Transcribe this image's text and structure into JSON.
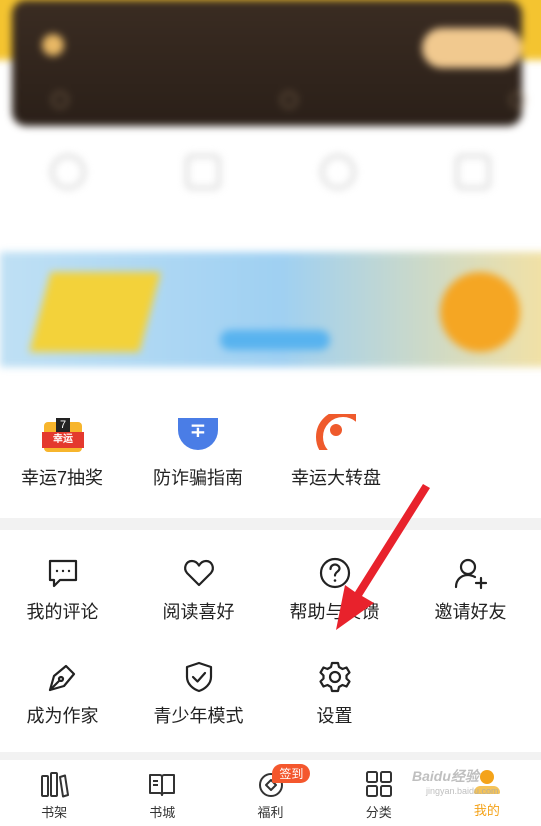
{
  "activities": [
    {
      "label": "幸运7抽奖",
      "icon": "lucky-seven-icon",
      "tag": "幸运",
      "num": "7"
    },
    {
      "label": "防诈骗指南",
      "icon": "anti-fraud-shield-icon",
      "glyph": "∓"
    },
    {
      "label": "幸运大转盘",
      "icon": "lucky-wheel-icon"
    }
  ],
  "tools": [
    {
      "label": "我的评论",
      "icon": "comment-icon"
    },
    {
      "label": "阅读喜好",
      "icon": "heart-icon"
    },
    {
      "label": "帮助与反馈",
      "icon": "help-icon"
    },
    {
      "label": "邀请好友",
      "icon": "invite-friend-icon"
    },
    {
      "label": "成为作家",
      "icon": "pen-icon"
    },
    {
      "label": "青少年模式",
      "icon": "teen-shield-icon"
    },
    {
      "label": "设置",
      "icon": "gear-icon"
    }
  ],
  "nav": {
    "shelf": "书架",
    "store": "书城",
    "welfare": "福利",
    "welfare_badge": "签到",
    "category": "分类",
    "me": "我的"
  },
  "watermark": {
    "brand": "Baidu经验",
    "sub": "jingyan.baidu.com"
  },
  "colors": {
    "accent": "#f4a31a",
    "badge": "#f4572d",
    "arrow": "#e8222c"
  }
}
